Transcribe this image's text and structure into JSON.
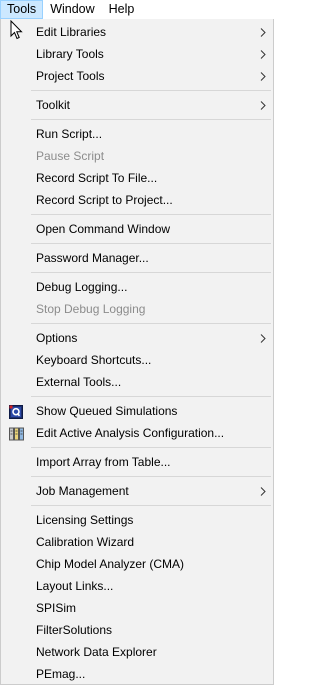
{
  "menubar": {
    "items": [
      "Tools",
      "Window",
      "Help"
    ]
  },
  "menu": {
    "edit_libraries": "Edit Libraries",
    "library_tools": "Library Tools",
    "project_tools": "Project Tools",
    "toolkit": "Toolkit",
    "run_script": "Run Script...",
    "pause_script": "Pause Script",
    "record_script_to_file": "Record Script To File...",
    "record_script_to_project": "Record Script to Project...",
    "open_command_window": "Open Command Window",
    "password_manager": "Password Manager...",
    "debug_logging": "Debug Logging...",
    "stop_debug_logging": "Stop Debug Logging",
    "options": "Options",
    "keyboard_shortcuts": "Keyboard Shortcuts...",
    "external_tools": "External Tools...",
    "show_queued_simulations": "Show Queued Simulations",
    "edit_active_analysis_configuration": "Edit Active Analysis Configuration...",
    "import_array_from_table": "Import Array from Table...",
    "job_management": "Job Management",
    "licensing_settings": "Licensing Settings",
    "calibration_wizard": "Calibration Wizard",
    "chip_model_analyzer": "Chip Model Analyzer (CMA)",
    "layout_links": "Layout Links...",
    "spisim": "SPISim",
    "filtersolutions": "FilterSolutions",
    "network_data_explorer": "Network Data Explorer",
    "pemag": "PEmag..."
  },
  "colors": {
    "menu_bg": "#f2f2f2",
    "active_menubar_bg": "#cce8ff",
    "disabled_text": "#8c8c8c",
    "separator": "#d7d7d7"
  }
}
